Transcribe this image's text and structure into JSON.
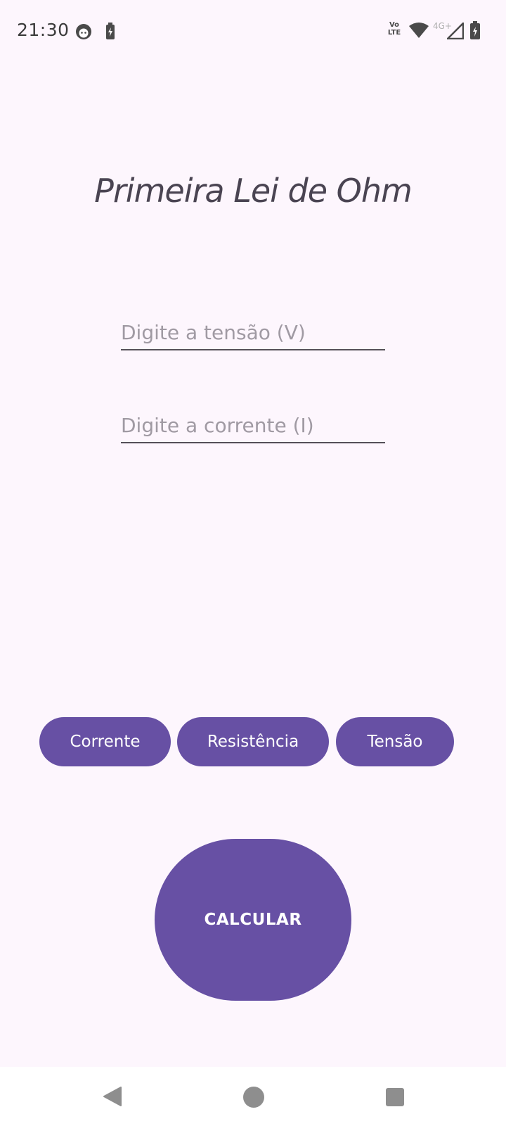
{
  "status_bar": {
    "time": "21:30",
    "volte_top": "Vo",
    "volte_bottom": "LTE",
    "network": "4G+",
    "icons": [
      "face-icon",
      "charging-icon",
      "wifi-icon",
      "signal-icon",
      "battery-icon"
    ]
  },
  "app": {
    "title": "Primeira Lei de Ohm"
  },
  "inputs": {
    "voltage": {
      "value": "",
      "placeholder": "Digite a tensão (V)"
    },
    "current": {
      "value": "",
      "placeholder": "Digite a corrente (I)"
    }
  },
  "modes": [
    {
      "label": "Corrente"
    },
    {
      "label": "Resistência"
    },
    {
      "label": "Tensão"
    }
  ],
  "calculate_label": "CALCULAR",
  "colors": {
    "background": "#fdf6fd",
    "accent": "#6750a4",
    "title": "#4a4452",
    "placeholder": "#a09aa3"
  },
  "nav_bar": {
    "icons": [
      "back-icon",
      "home-icon",
      "recents-icon"
    ]
  }
}
